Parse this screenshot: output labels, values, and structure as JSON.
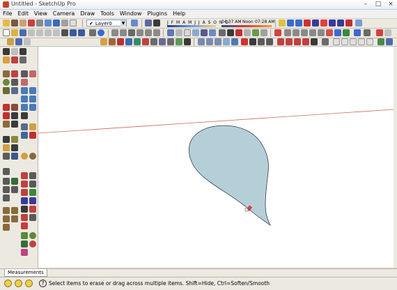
{
  "window": {
    "title": "Untitled - SketchUp Pro",
    "minimize": "–",
    "maximize": "□",
    "close": "×"
  },
  "menu": [
    "File",
    "Edit",
    "View",
    "Camera",
    "Draw",
    "Tools",
    "Window",
    "Plugins",
    "Help"
  ],
  "toolbar": {
    "layer_value": "Layer0",
    "layer_check": "✔",
    "months": "J F M A M J J A S O N D",
    "time_label": "04:37",
    "time_am": "AM",
    "noon": "Noon",
    "time_pm": "07:28",
    "pm_label": "AM"
  },
  "viewport": {
    "background": "#ffffff",
    "shape_fill": "#b5cfd8",
    "axis_color": "#c66a5a"
  },
  "measurements": {
    "tab_label": "Measurements"
  },
  "status": {
    "help_icon": "?",
    "message": "Select items to erase or drag across multiple items. Shift=Hide, Ctrl=Soften/Smooth"
  }
}
